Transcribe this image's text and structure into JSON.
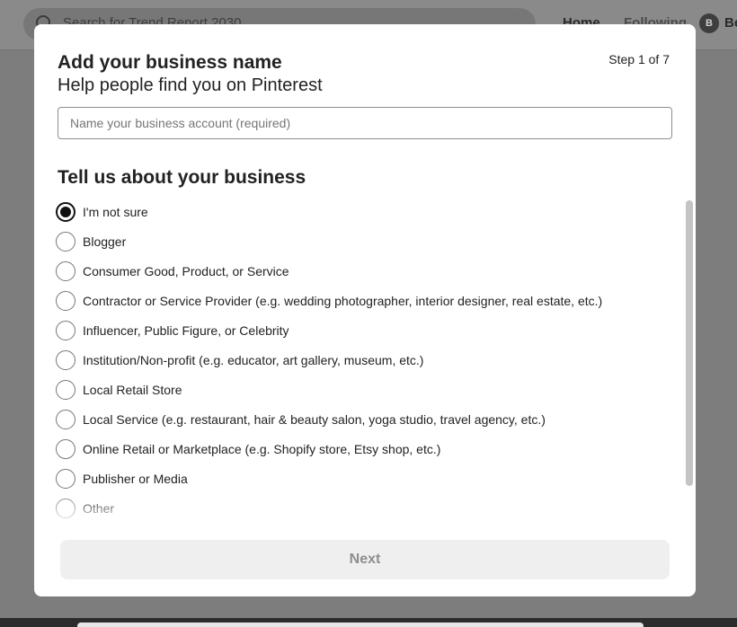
{
  "background": {
    "search": {
      "placeholder": "Search for Trend Report 2030"
    },
    "nav": {
      "home": "Home",
      "following": "Following"
    },
    "avatar_initial": "B",
    "user_name_partial": "Be"
  },
  "modal": {
    "title": "Add your business name",
    "subtitle": "Help people find you on Pinterest",
    "step": "Step 1 of 7",
    "name_input": {
      "value": "",
      "placeholder": "Name your business account (required)"
    },
    "section_title": "Tell us about your business",
    "options": [
      {
        "label": "I'm not sure",
        "checked": true
      },
      {
        "label": "Blogger",
        "checked": false
      },
      {
        "label": "Consumer Good, Product, or Service",
        "checked": false
      },
      {
        "label": "Contractor or Service Provider (e.g. wedding photographer, interior designer, real estate, etc.)",
        "checked": false
      },
      {
        "label": "Influencer, Public Figure, or Celebrity",
        "checked": false
      },
      {
        "label": "Institution/Non-profit (e.g. educator, art gallery, museum, etc.)",
        "checked": false
      },
      {
        "label": "Local Retail Store",
        "checked": false
      },
      {
        "label": "Local Service (e.g. restaurant, hair & beauty salon, yoga studio, travel agency, etc.)",
        "checked": false
      },
      {
        "label": "Online Retail or Marketplace (e.g. Shopify store, Etsy shop, etc.)",
        "checked": false
      },
      {
        "label": "Publisher or Media",
        "checked": false
      },
      {
        "label": "Other",
        "checked": false
      }
    ],
    "next_label": "Next"
  },
  "colors": {
    "overlay": "#7d7d7d",
    "modal_bg": "#ffffff",
    "text": "#222222",
    "radio_checked": "#111111",
    "button_disabled_bg": "#efefef",
    "button_disabled_text": "#8e8e8e"
  }
}
